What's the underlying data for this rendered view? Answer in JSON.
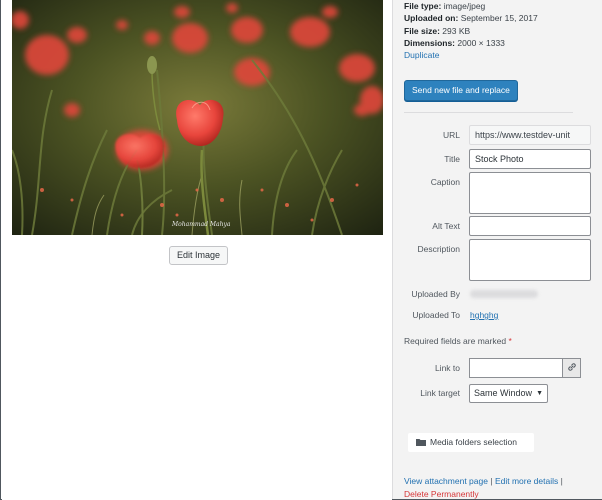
{
  "photo": {
    "watermark": "Mohammad Mahya"
  },
  "left": {
    "edit_image_label": "Edit Image"
  },
  "meta": {
    "file_type": {
      "label": "File type:",
      "value": "image/jpeg"
    },
    "uploaded_on": {
      "label": "Uploaded on:",
      "value": "September 15, 2017"
    },
    "file_size": {
      "label": "File size:",
      "value": "293 KB"
    },
    "dimensions": {
      "label": "Dimensions:",
      "value": "2000 × 1333"
    },
    "duplicate_label": "Duplicate"
  },
  "replace_button_label": "Send new file and replace",
  "fields": {
    "url": {
      "label": "URL",
      "value": "https://www.testdev-unit"
    },
    "title": {
      "label": "Title",
      "value": "Stock Photo"
    },
    "caption": {
      "label": "Caption",
      "value": ""
    },
    "alt_text": {
      "label": "Alt Text",
      "value": ""
    },
    "description": {
      "label": "Description",
      "value": ""
    }
  },
  "uploaded_by": {
    "label": "Uploaded By"
  },
  "uploaded_to": {
    "label": "Uploaded To",
    "value": "hghghg"
  },
  "required_note": {
    "text": "Required fields are marked",
    "star": "*"
  },
  "link_to": {
    "label": "Link to",
    "value": ""
  },
  "link_target": {
    "label": "Link target",
    "selected": "Same Window"
  },
  "folders_button_label": "Media folders selection",
  "actions": {
    "view_attachment": "View attachment page",
    "separator": "|",
    "edit_more": "Edit more details",
    "delete": "Delete Permanently"
  },
  "colors": {
    "accent": "#2271b1",
    "primary_button": "#2e82be",
    "danger": "#d63638",
    "poppy": "#e8453c"
  }
}
